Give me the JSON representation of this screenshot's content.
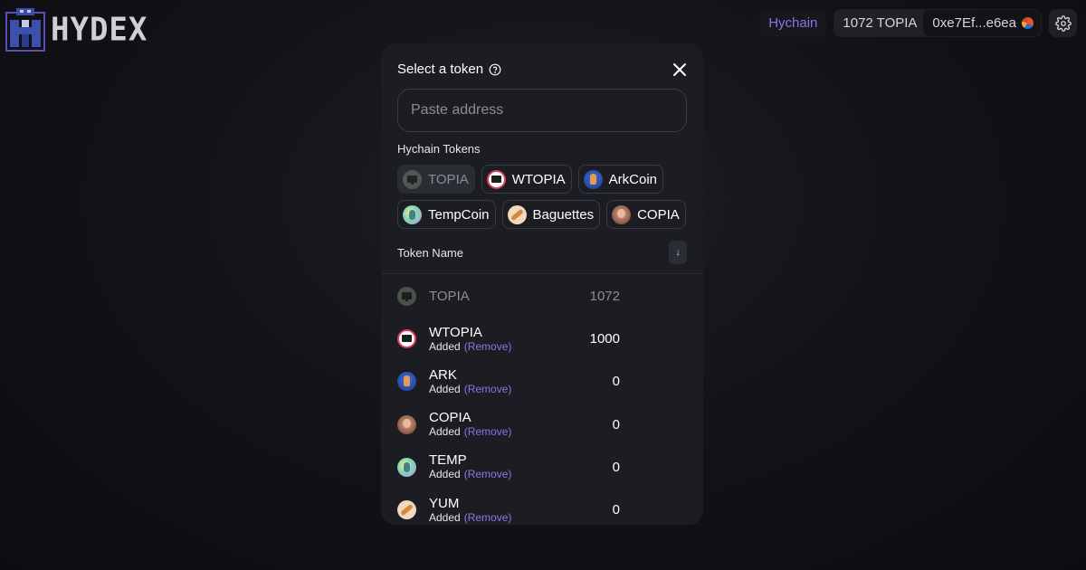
{
  "header": {
    "logo_text": "HYDEX",
    "network_label": "Hychain",
    "balance": "1072 TOPIA",
    "address": "0xe7Ef...e6ea"
  },
  "modal": {
    "title": "Select a token",
    "search_placeholder": "Paste address",
    "section_label": "Hychain Tokens",
    "chips": [
      {
        "label": "TOPIA",
        "icon": "topia-token-icon",
        "selected": true
      },
      {
        "label": "WTOPIA",
        "icon": "wtopia-token-icon",
        "selected": false
      },
      {
        "label": "ArkCoin",
        "icon": "arkcoin-token-icon",
        "selected": false
      },
      {
        "label": "TempCoin",
        "icon": "tempcoin-token-icon",
        "selected": false
      },
      {
        "label": "Baguettes",
        "icon": "baguettes-token-icon",
        "selected": false
      },
      {
        "label": "COPIA",
        "icon": "copia-token-icon",
        "selected": false
      }
    ],
    "list_header": "Token Name",
    "sort_icon": "↓",
    "tokens": [
      {
        "symbol": "TOPIA",
        "status": "",
        "remove_label": "",
        "balance": "1072",
        "icon": "topia-token-icon"
      },
      {
        "symbol": "WTOPIA",
        "status": "Added",
        "remove_label": "(Remove)",
        "balance": "1000",
        "icon": "wtopia-token-icon"
      },
      {
        "symbol": "ARK",
        "status": "Added",
        "remove_label": "(Remove)",
        "balance": "0",
        "icon": "arkcoin-token-icon"
      },
      {
        "symbol": "COPIA",
        "status": "Added",
        "remove_label": "(Remove)",
        "balance": "0",
        "icon": "copia-token-icon"
      },
      {
        "symbol": "TEMP",
        "status": "Added",
        "remove_label": "(Remove)",
        "balance": "0",
        "icon": "tempcoin-token-icon"
      },
      {
        "symbol": "YUM",
        "status": "Added",
        "remove_label": "(Remove)",
        "balance": "0",
        "icon": "baguettes-token-icon"
      }
    ]
  },
  "colors": {
    "accent": "#8e74e6",
    "modal_bg": "#1c1d23",
    "page_bg": "#111216"
  }
}
